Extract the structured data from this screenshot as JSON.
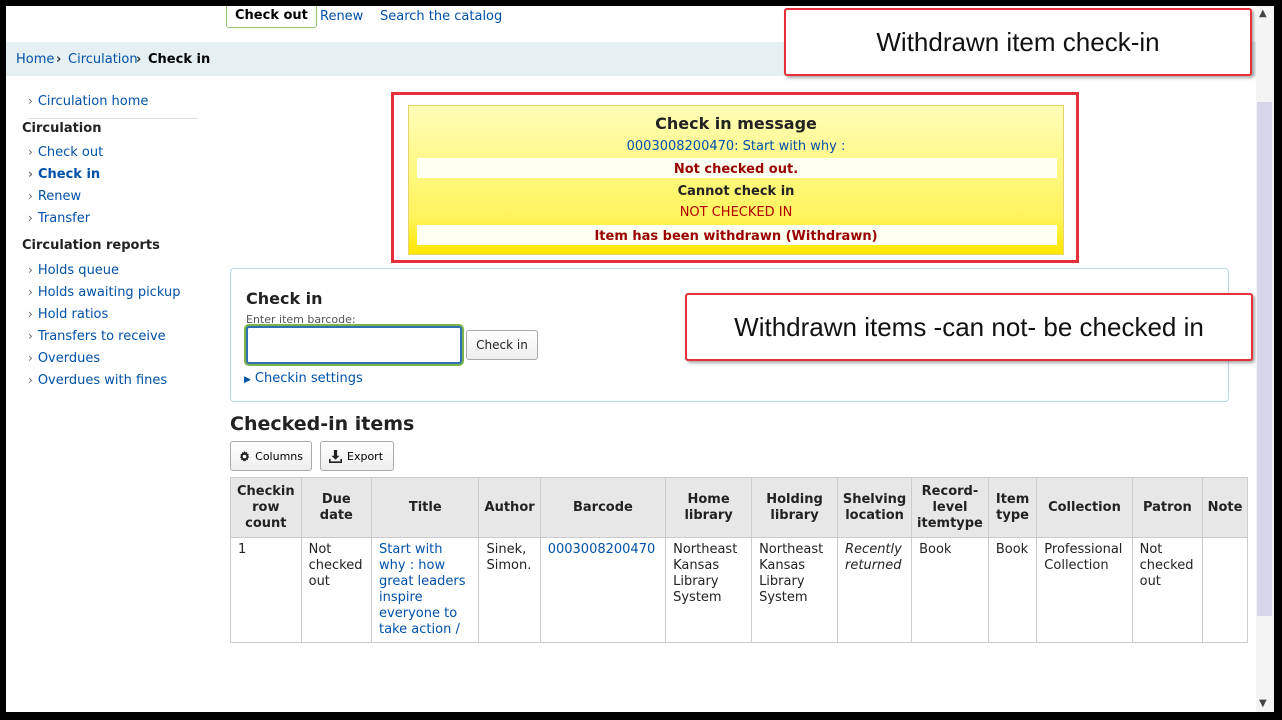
{
  "topnav": {
    "checkout": "Check out",
    "renew": "Renew",
    "search": "Search the catalog"
  },
  "breadcrumb": {
    "home": "Home",
    "sep": "›",
    "circulation": "Circulation",
    "current": "Check in"
  },
  "sidebar": {
    "home": "Circulation home",
    "circulation_head": "Circulation",
    "checkout": "Check out",
    "checkin": "Check in",
    "renew": "Renew",
    "transfer": "Transfer",
    "reports_head": "Circulation reports",
    "holds_queue": "Holds queue",
    "holds_awaiting": "Holds awaiting pickup",
    "hold_ratios": "Hold ratios",
    "transfers": "Transfers to receive",
    "overdues": "Overdues",
    "overdues_fines": "Overdues with fines"
  },
  "message": {
    "title": "Check in message",
    "item": "0003008200470: Start with why :",
    "not_checked_out": "Not checked out.",
    "cannot": "Cannot check in",
    "not_checked_in": "NOT CHECKED IN",
    "withdrawn": "Item has been withdrawn (Withdrawn)"
  },
  "checkin": {
    "title": "Check in",
    "label": "Enter item barcode:",
    "value": "",
    "button": "Check in",
    "settings": "Checkin settings"
  },
  "callouts": {
    "top": "Withdrawn item check-in",
    "middle": "Withdrawn items -can not- be checked in"
  },
  "items": {
    "title": "Checked-in items",
    "columns_btn": "Columns",
    "export_btn": "Export",
    "headers": {
      "row_count": "Checkin row count",
      "due_date": "Due date",
      "title": "Title",
      "author": "Author",
      "barcode": "Barcode",
      "home_library": "Home library",
      "holding_library": "Holding library",
      "shelving": "Shelving location",
      "record_itemtype": "Record-level itemtype",
      "item_type": "Item type",
      "collection": "Collection",
      "patron": "Patron",
      "note": "Note"
    },
    "row": {
      "row_count": "1",
      "due_date": "Not checked out",
      "title": "Start with why : how great leaders inspire everyone to take action /",
      "author": "Sinek, Simon.",
      "barcode": "0003008200470",
      "home_library": "Northeast Kansas Library System",
      "holding_library": "Northeast Kansas Library System",
      "shelving": "Recently returned",
      "record_itemtype": "Book",
      "item_type": "Book",
      "collection": "Professional Collection",
      "patron": "Not checked out",
      "note": ""
    }
  },
  "colors": {
    "link": "#0051a8",
    "alert_border": "#e8303a",
    "message_yellow": "#fff45c",
    "dark_red": "#990000"
  }
}
